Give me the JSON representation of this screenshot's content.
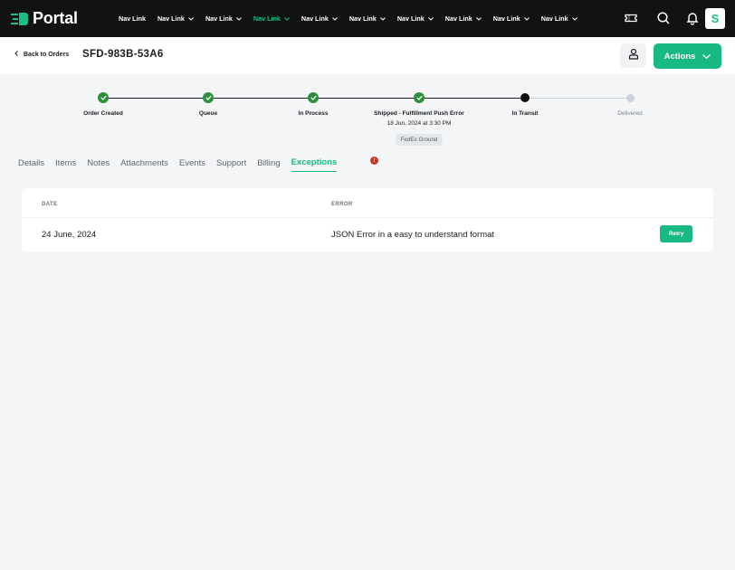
{
  "app": {
    "name": "Portal",
    "accent": "#18b983",
    "topbar_bg": "#101214"
  },
  "nav": {
    "items": [
      {
        "label": "Nav Link",
        "has_chevron": false,
        "active": false
      },
      {
        "label": "Nav Link",
        "has_chevron": true,
        "active": false
      },
      {
        "label": "Nav Link",
        "has_chevron": true,
        "active": false
      },
      {
        "label": "Nav Link",
        "has_chevron": true,
        "active": true
      },
      {
        "label": "Nav Link",
        "has_chevron": true,
        "active": false
      },
      {
        "label": "Nav Link",
        "has_chevron": true,
        "active": false
      },
      {
        "label": "Nav Link",
        "has_chevron": true,
        "active": false
      },
      {
        "label": "Nav Link",
        "has_chevron": true,
        "active": false
      },
      {
        "label": "Nav Link",
        "has_chevron": true,
        "active": false
      },
      {
        "label": "Nav Link",
        "has_chevron": true,
        "active": false
      }
    ],
    "icons": [
      "ticket-icon",
      "search-icon",
      "bell-icon"
    ],
    "avatar_initial": "S"
  },
  "header": {
    "back_label": "Back to Orders",
    "order_id": "SFD-983B-53A6",
    "actions_label": "Actions"
  },
  "stepper": {
    "steps": [
      {
        "label": "Order Created",
        "status": "done"
      },
      {
        "label": "Queue",
        "status": "done"
      },
      {
        "label": "In Process",
        "status": "done"
      },
      {
        "label": "Shipped - Fulfillment Push Error",
        "status": "done",
        "sub": "18 Jun, 2024 at 3:30 PM",
        "badge": "FedEx Ground"
      },
      {
        "label": "In Transit",
        "status": "current"
      },
      {
        "label": "Delivered",
        "status": "pending"
      }
    ]
  },
  "tabs": {
    "items": [
      "Details",
      "Items",
      "Notes",
      "Attachments",
      "Events",
      "Support",
      "Billing",
      "Exceptions"
    ],
    "active": "Exceptions",
    "alert_glyph": "!"
  },
  "exceptions": {
    "columns": [
      "DATE",
      "ERROR"
    ],
    "rows": [
      {
        "date": "24 June, 2024",
        "error": "JSON Error in a easy to understand format",
        "action": "Retry"
      }
    ]
  }
}
